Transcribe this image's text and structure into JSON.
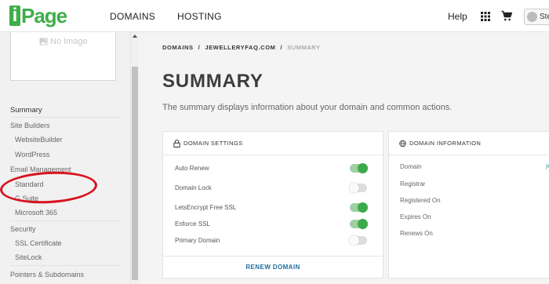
{
  "brand": {
    "logo_letter": "i",
    "logo_rest": "Page",
    "color": "#3fae49"
  },
  "topnav": {
    "links": [
      "DOMAINS",
      "HOSTING"
    ],
    "help": "Help",
    "user_name": "Ste",
    "icons": [
      "apps-grid-icon",
      "cart-icon",
      "user-avatar-icon"
    ]
  },
  "sidebar": {
    "no_image_text": "No Image",
    "items": [
      {
        "label": "Summary",
        "kind": "active"
      },
      {
        "label": "Site Builders",
        "kind": "head"
      },
      {
        "label": "WebsiteBuilder",
        "kind": "sub"
      },
      {
        "label": "WordPress",
        "kind": "sub"
      },
      {
        "label": "Email Management",
        "kind": "head"
      },
      {
        "label": "Standard",
        "kind": "sub"
      },
      {
        "label": "G Suite",
        "kind": "sub"
      },
      {
        "label": "Microsoft 365",
        "kind": "sub"
      },
      {
        "label": "Security",
        "kind": "head"
      },
      {
        "label": "SSL Certificate",
        "kind": "sub"
      },
      {
        "label": "SiteLock",
        "kind": "sub"
      },
      {
        "label": "Pointers & Subdomains",
        "kind": "head"
      }
    ],
    "annotation_color": "#d8131d"
  },
  "breadcrumb": [
    "DOMAINS",
    "/",
    "JEWELLERYFAQ.COM",
    "/",
    "SUMMARY"
  ],
  "page": {
    "title": "SUMMARY",
    "description": "The summary displays information about your domain and common actions."
  },
  "domain_settings": {
    "title": "DOMAIN SETTINGS",
    "rows": [
      {
        "label": "Auto Renew",
        "on": true
      },
      {
        "label": "Domain Lock",
        "on": false
      },
      {
        "label": "LetsEncrypt Free SSL",
        "on": true
      },
      {
        "label": "Enforce SSL",
        "on": true
      },
      {
        "label": "Primary Domain",
        "on": false
      }
    ],
    "renew_label": "RENEW DOMAIN",
    "toggle_on_color": "#3aaa4b"
  },
  "domain_information": {
    "title": "DOMAIN INFORMATION",
    "rows": [
      "Domain",
      "Registrar",
      "Registered On",
      "Expires On",
      "Renews On"
    ],
    "domain_value_fragment": "je"
  }
}
